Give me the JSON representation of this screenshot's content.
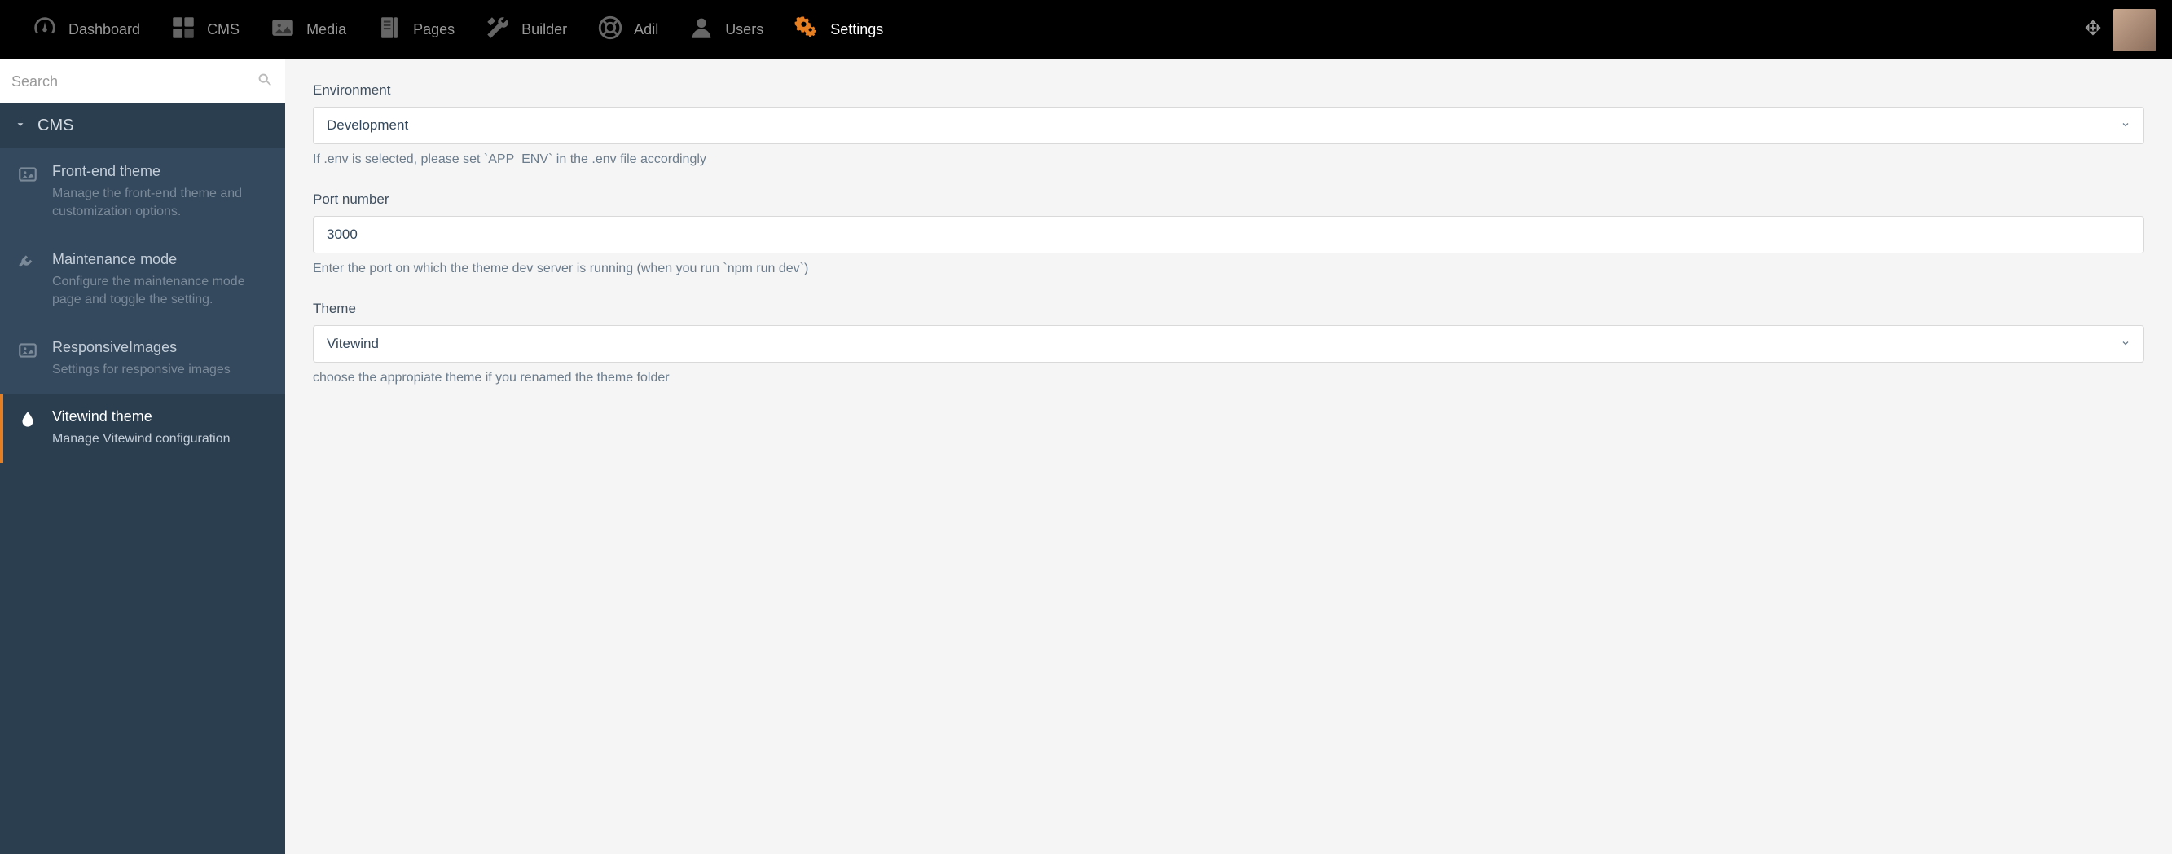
{
  "topnav": {
    "items": [
      {
        "label": "Dashboard",
        "active": false,
        "icon": "gauge"
      },
      {
        "label": "CMS",
        "active": false,
        "icon": "cms"
      },
      {
        "label": "Media",
        "active": false,
        "icon": "media"
      },
      {
        "label": "Pages",
        "active": false,
        "icon": "pages"
      },
      {
        "label": "Builder",
        "active": false,
        "icon": "wrench"
      },
      {
        "label": "Adil",
        "active": false,
        "icon": "lifebuoy"
      },
      {
        "label": "Users",
        "active": false,
        "icon": "user"
      },
      {
        "label": "Settings",
        "active": true,
        "icon": "gears"
      }
    ]
  },
  "sidebar": {
    "search_placeholder": "Search",
    "group_label": "CMS",
    "items": [
      {
        "title": "Front-end theme",
        "desc": "Manage the front-end theme and customization options.",
        "icon": "image",
        "active": false
      },
      {
        "title": "Maintenance mode",
        "desc": "Configure the maintenance mode page and toggle the setting.",
        "icon": "plug",
        "active": false
      },
      {
        "title": "ResponsiveImages",
        "desc": "Settings for responsive images",
        "icon": "image",
        "active": false
      },
      {
        "title": "Vitewind theme",
        "desc": "Manage Vitewind configuration",
        "icon": "drop",
        "active": true
      }
    ]
  },
  "form": {
    "environment": {
      "label": "Environment",
      "value": "Development",
      "help": "If .env is selected, please set `APP_ENV` in the .env file accordingly"
    },
    "port": {
      "label": "Port number",
      "value": "3000",
      "help": "Enter the port on which the theme dev server is running (when you run `npm run dev`)"
    },
    "theme": {
      "label": "Theme",
      "value": "Vitewind",
      "help": "choose the appropiate theme if you renamed the theme folder"
    }
  }
}
